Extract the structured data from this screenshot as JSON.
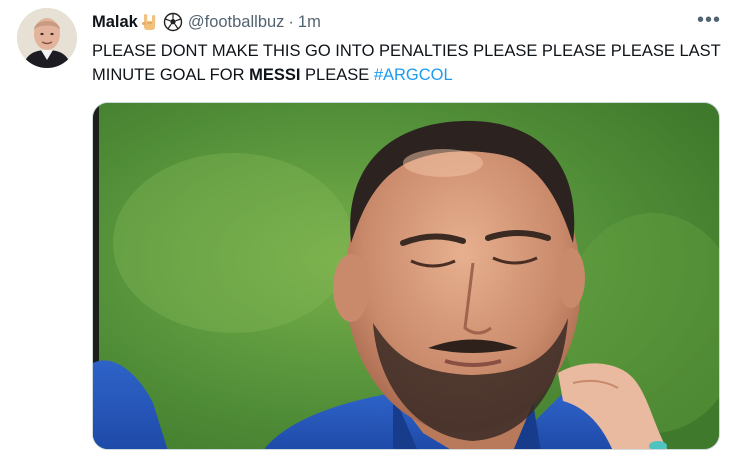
{
  "tweet": {
    "author_name": "Malak",
    "author_handle": "@footballbuz",
    "separator": "·",
    "time": "1m",
    "more_label": "•••",
    "text_part1": "PLEASE DONT MAKE THIS GO INTO PENALTIES PLEASE PLEASE PLEASE LAST MINUTE GOAL FOR ",
    "text_bold": "MESSI",
    "text_part2": " PLEASE ",
    "hashtag": "#ARGCOL",
    "name_emojis": [
      "sign-of-horns-emoji",
      "soccer-ball-emoji"
    ]
  },
  "colors": {
    "text": "#0f1419",
    "secondary": "#536471",
    "link": "#1d9bf0"
  }
}
